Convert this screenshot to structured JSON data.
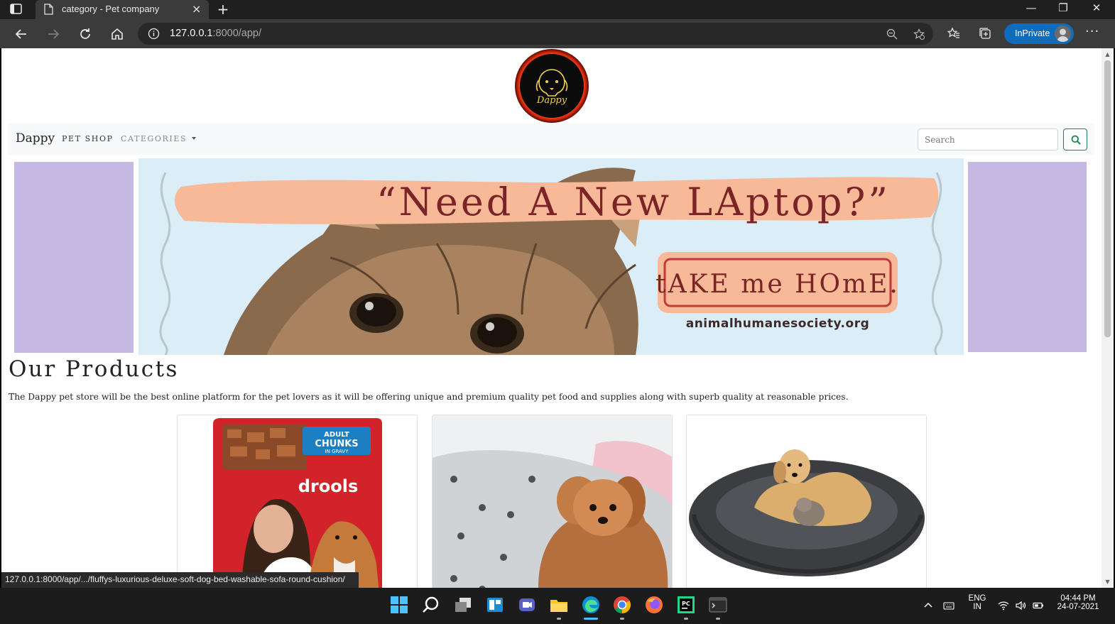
{
  "browser": {
    "tab_title": "category - Pet company",
    "tab_close": "×",
    "new_tab": "+",
    "url_host": "127.0.0.1",
    "url_rest": ":8000/app/",
    "inprivate_label": "InPrivate",
    "more": "···",
    "status_url": "127.0.0.1:8000/app/.../fluffys-luxurious-deluxe-soft-dog-bed-washable-sofa-round-cushion/"
  },
  "page": {
    "logo_text": "Dappy",
    "brand": "Dappy",
    "nav": {
      "pet_shop": "PET SHOP",
      "categories": "CATEGORIES"
    },
    "search": {
      "placeholder": "Search"
    },
    "banner": {
      "headline": "“Need A New LAptop?”",
      "cta": "tAKE me HOmE.",
      "site": "animalhumanesociety.org"
    },
    "heading": "Our Products",
    "description": "The Dappy pet store will be the best online platform for the pet lovers as it will be offering unique and premium quality pet food and supplies along with superb quality at reasonable prices.",
    "products": [
      {
        "image": "drools-adult-chunks-pouch",
        "pack_top": "ADULT",
        "pack_mid": "CHUNKS",
        "pack_sub": "IN GRAVY",
        "brand": "drools"
      },
      {
        "image": "puppy-on-paw-print-blanket"
      },
      {
        "image": "dog-and-cat-on-round-bed"
      }
    ]
  },
  "taskbar": {
    "language": "ENG",
    "region": "IN",
    "time": "04:44 PM",
    "date": "24-07-2021"
  },
  "colors": {
    "accent_blue": "#0f6cbd",
    "side_panel": "#c5b9e3",
    "banner_bg": "#dbeef8",
    "search_btn": "#198754"
  }
}
